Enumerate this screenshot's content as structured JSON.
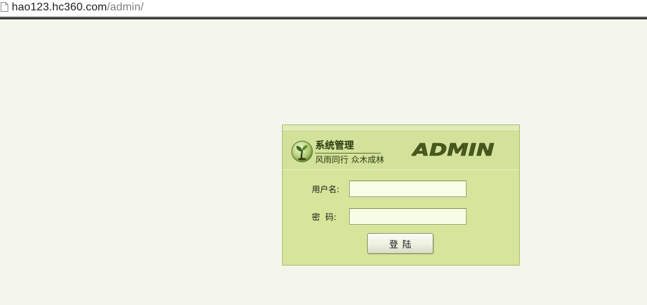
{
  "browser": {
    "url_host": "hao123.hc360.com",
    "url_path": "/admin/"
  },
  "header": {
    "title": "系统管理",
    "slogan": "风雨同行  众木成林",
    "logo_text": "ADMIN"
  },
  "form": {
    "username_label": "用户名:",
    "username_value": "",
    "password_label": "密  码:",
    "password_value": "",
    "submit_label": "登陆"
  },
  "colors": {
    "page_background": "#f3f5ec",
    "panel_background": "#d5e59a",
    "input_background": "#f8fde6",
    "logo_text": "#4a5a1e"
  },
  "icons": {
    "page": "page-icon",
    "logo": "tree-seedling-icon"
  }
}
